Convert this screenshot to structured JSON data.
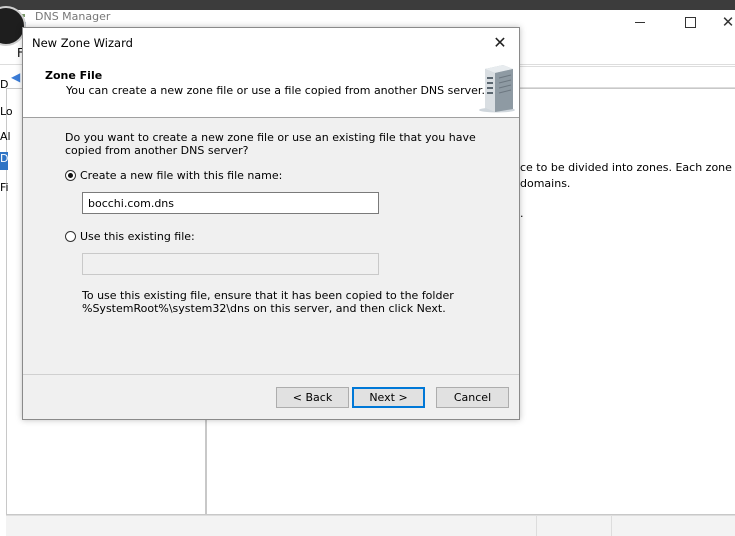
{
  "background_window": {
    "title": "DNS Manager",
    "menu_letter": "F",
    "tree_letters": [
      "D",
      "Lo",
      "Al",
      "D",
      "Fi"
    ],
    "description_line1": "ce to be divided into zones. Each zone",
    "description_line2": "domains.",
    "description_line3": "."
  },
  "wizard": {
    "title": "New Zone Wizard",
    "header_title": "Zone File",
    "header_subtitle": "You can create a new zone file or use a file copied from another DNS server.",
    "question": "Do you want to create a new zone file or use an existing file that you have copied from another DNS server?",
    "options": [
      {
        "label": "Create a new file with this file name:",
        "selected": true
      },
      {
        "label": "Use this existing file:",
        "selected": false
      }
    ],
    "new_file_value": "bocchi.com.dns",
    "existing_file_value": "",
    "hint": "To use this existing file, ensure that it has been copied to the folder %SystemRoot%\\system32\\dns on this server, and then click Next.",
    "buttons": {
      "back": "< Back",
      "next": "Next >",
      "cancel": "Cancel"
    }
  },
  "colors": {
    "accent": "#0078d7",
    "selection": "#2f74c5"
  },
  "icons": [
    "server-icon",
    "close-icon",
    "back-arrow-icon",
    "dns-icon"
  ]
}
